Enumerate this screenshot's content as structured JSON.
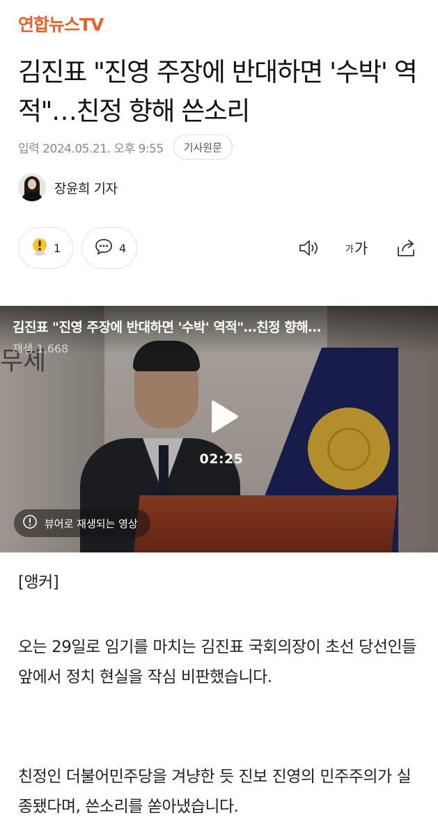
{
  "brand": {
    "name": "연합뉴스TV",
    "color": "#e8622a"
  },
  "article": {
    "headline": "김진표 \"진영 주장에 반대하면 '수박' 역적\"…친정 향해 쓴소리",
    "date": "입력 2024.05.21. 오후 9:55",
    "original_button": "기사원문",
    "reporter": "장윤희 기자"
  },
  "actions": {
    "reaction_count": "1",
    "comment_count": "4",
    "font_label_small": "가",
    "font_label_big": "가",
    "icons": [
      "exclamation-reaction-icon",
      "comment-bubble-icon",
      "speaker-icon",
      "font-size-icon",
      "share-icon"
    ]
  },
  "video": {
    "title": "김진표 \"진영 주장에 반대하면 '수박' 역적\"…친정 향해…",
    "views": "재생 1,668",
    "duration": "02:25",
    "viewer_notice": "뷰어로 재생되는 영상",
    "wall_text": "무제"
  },
  "body": {
    "anchor_tag": "[앵커]",
    "paragraphs": [
      "오는 29일로 임기를 마치는 김진표 국회의장이 초선 당선인들 앞에서 정치 현실을 작심 비판했습니다.",
      "친정인 더불어민주당을 겨냥한 듯 진보 진영의 민주주의가 실종됐다며, 쓴소리를 쏟아냈습니다."
    ]
  }
}
